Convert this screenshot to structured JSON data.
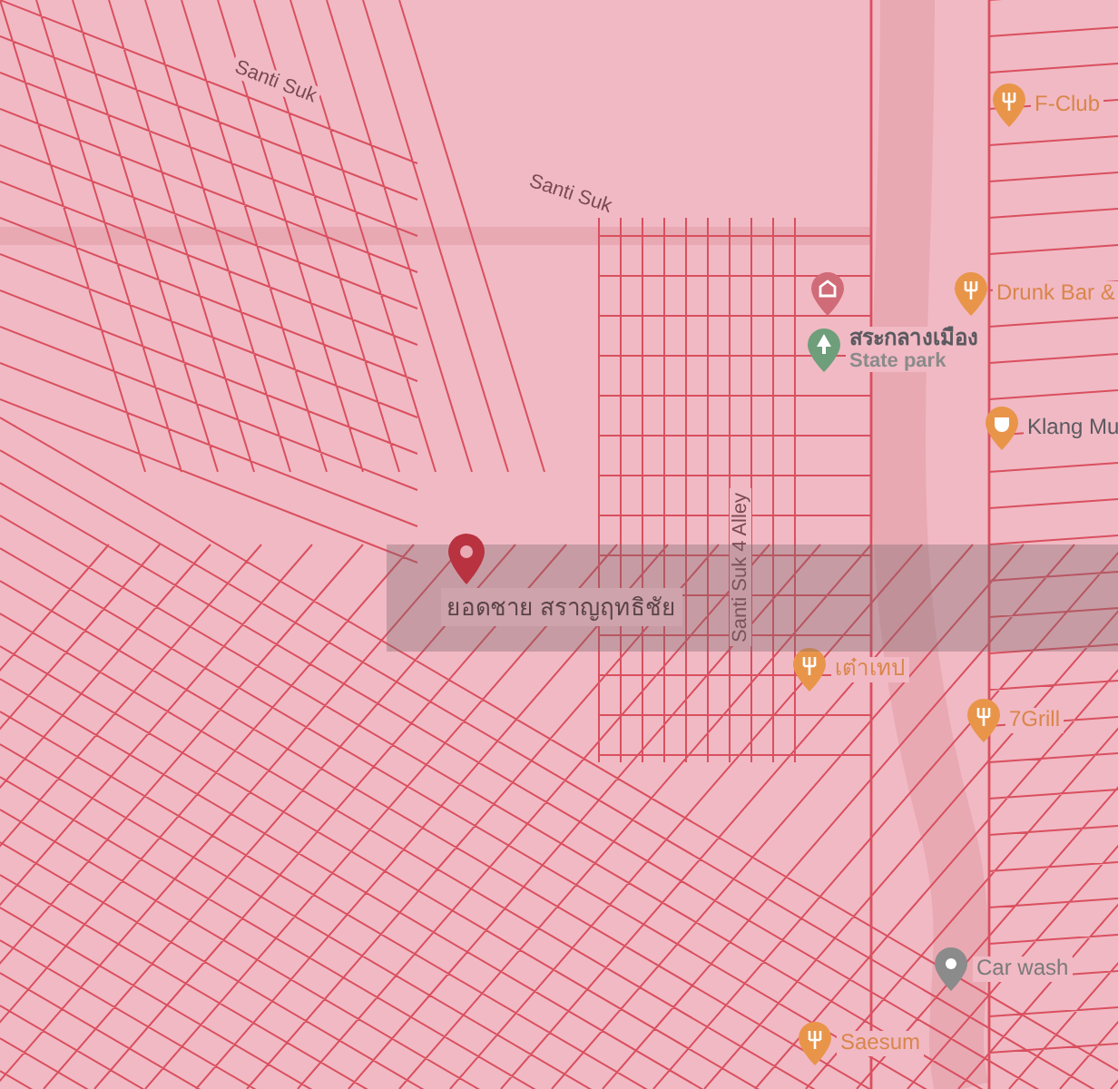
{
  "location_card": {
    "name": "ยอดชาย สราญฤทธิชัย"
  },
  "streets": [
    {
      "text": "Santi Suk"
    },
    {
      "text": "Santi Suk"
    },
    {
      "text": "Santi Suk 4 Alley"
    }
  ],
  "places": [
    {
      "label": "F-Club",
      "kind": "restaurant"
    },
    {
      "label": "Drunk Bar &",
      "kind": "restaurant"
    },
    {
      "label": "สระกลางเมือง",
      "sublabel": "State park",
      "kind": "park"
    },
    {
      "label": "Klang Mu",
      "kind": "cafe"
    },
    {
      "label": "เต๋าเทป",
      "kind": "restaurant"
    },
    {
      "label": "7Grill",
      "kind": "restaurant"
    },
    {
      "label": "Car wash",
      "kind": "place"
    },
    {
      "label": "Saesum",
      "kind": "restaurant"
    },
    {
      "kind": "shop"
    }
  ]
}
